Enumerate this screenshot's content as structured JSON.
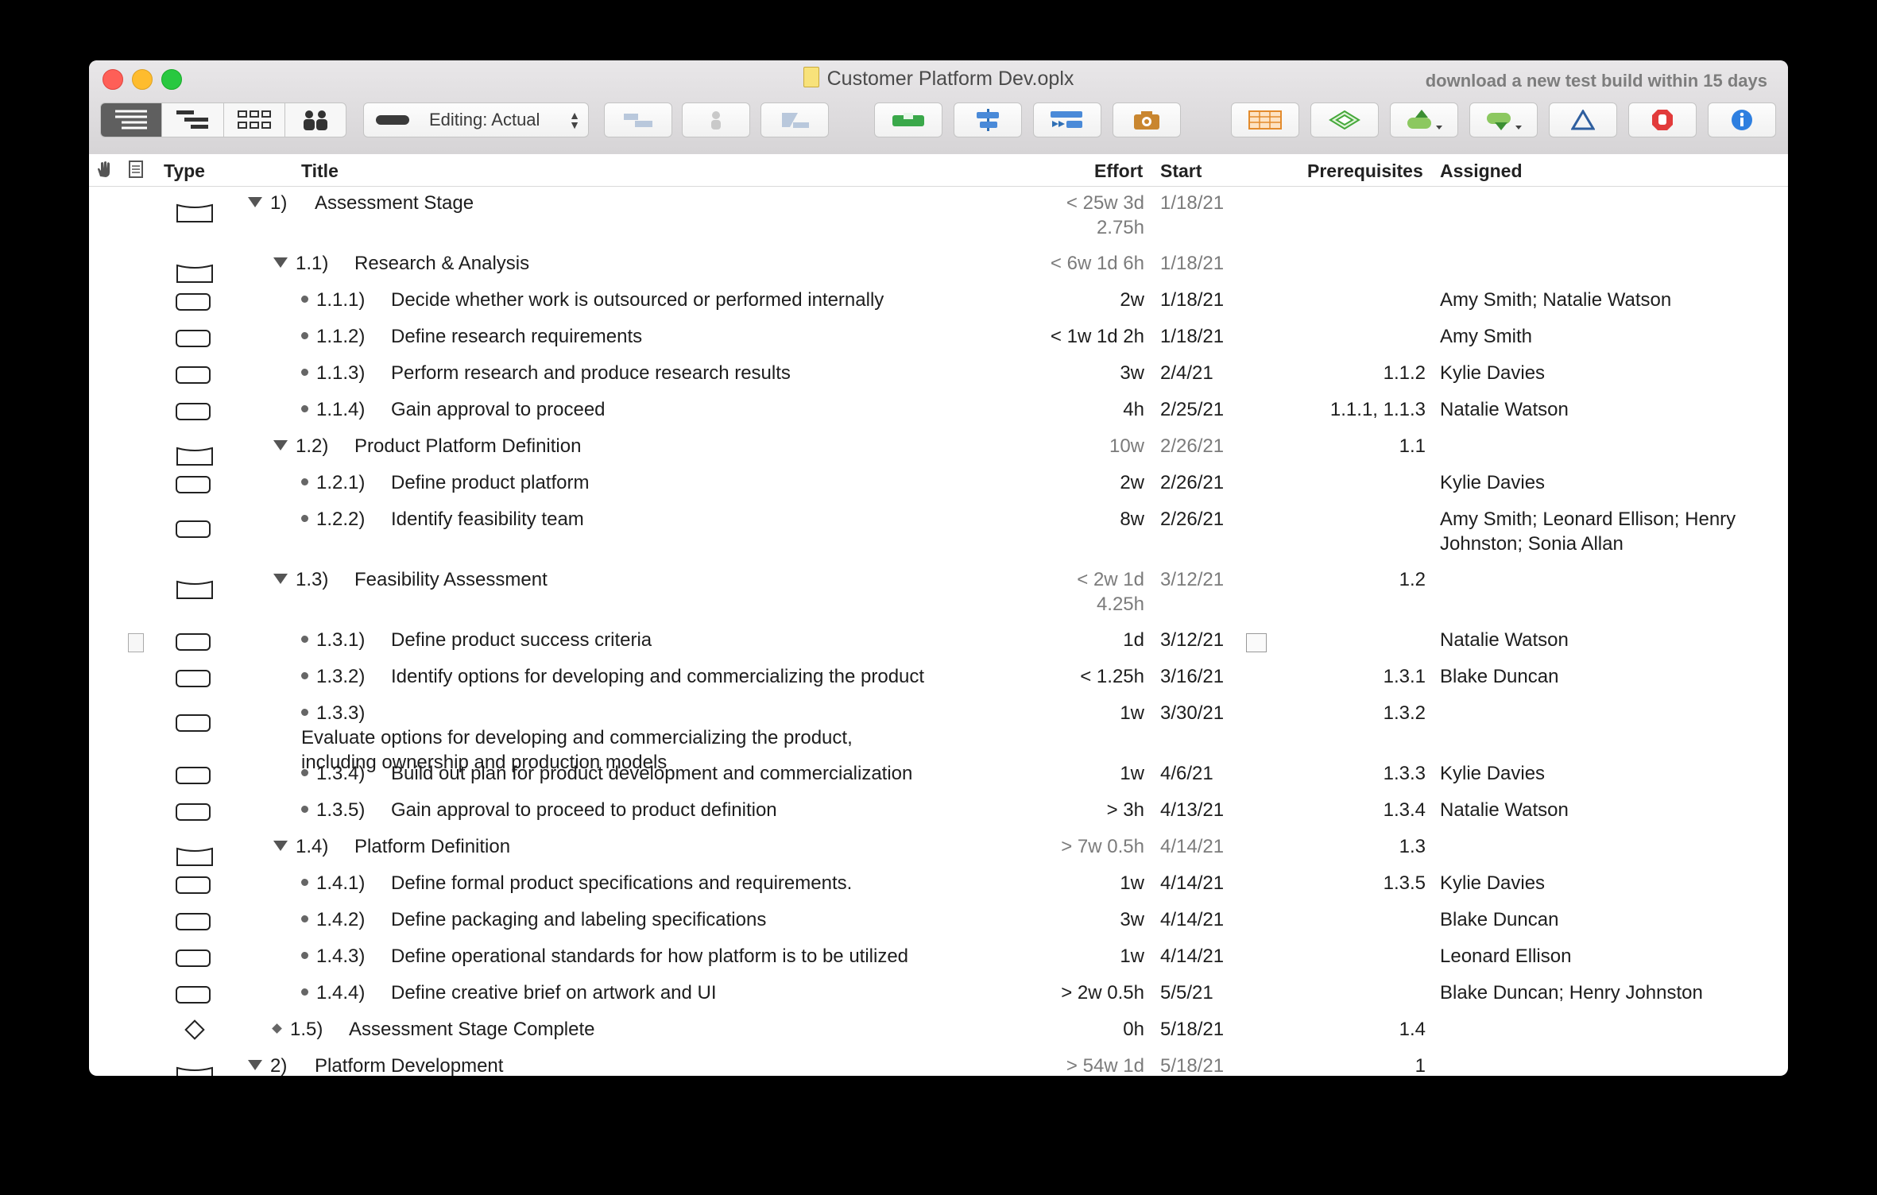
{
  "window": {
    "title": "Customer Platform Dev.oplx",
    "notice": "download a new test build within 15 days"
  },
  "toolbar": {
    "view_modes": [
      "task-outline",
      "gantt",
      "network",
      "resources"
    ],
    "editing_label": "Editing: Actual",
    "buttons": [
      "connect",
      "assign-resource",
      "split",
      "level",
      "center",
      "catch-up",
      "snapshot",
      "spreadsheet",
      "baseline",
      "publish",
      "import",
      "violations",
      "stop",
      "inspector"
    ]
  },
  "columns": {
    "type": "Type",
    "title": "Title",
    "effort": "Effort",
    "start": "Start",
    "prerequisites": "Prerequisites",
    "assigned": "Assigned"
  },
  "rows": [
    {
      "num": "1)",
      "title": "Assessment Stage",
      "effort": "< 25w 3d 2.75h",
      "start": "1/18/21",
      "prereq": "",
      "assigned": "",
      "kind": "group",
      "level": 0,
      "mark": "tri"
    },
    {
      "num": "1.1)",
      "title": "Research & Analysis",
      "effort": "< 6w 1d 6h",
      "start": "1/18/21",
      "prereq": "",
      "assigned": "",
      "kind": "group",
      "level": 1,
      "mark": "tri"
    },
    {
      "num": "1.1.1)",
      "title": "Decide whether work is outsourced or performed internally",
      "effort": "2w",
      "start": "1/18/21",
      "prereq": "",
      "assigned": "Amy Smith; Natalie Watson",
      "kind": "task",
      "level": 2,
      "mark": "dot"
    },
    {
      "num": "1.1.2)",
      "title": "Define research requirements",
      "effort": "< 1w 1d 2h",
      "start": "1/18/21",
      "prereq": "",
      "assigned": "Amy Smith",
      "kind": "task",
      "level": 2,
      "mark": "dot"
    },
    {
      "num": "1.1.3)",
      "title": "Perform research and produce research results",
      "effort": "3w",
      "start": "2/4/21",
      "prereq": "1.1.2",
      "assigned": "Kylie Davies",
      "kind": "task",
      "level": 2,
      "mark": "dot"
    },
    {
      "num": "1.1.4)",
      "title": "Gain approval to proceed",
      "effort": "4h",
      "start": "2/25/21",
      "prereq": "1.1.1, 1.1.3",
      "assigned": "Natalie Watson",
      "kind": "task",
      "level": 2,
      "mark": "dot"
    },
    {
      "num": "1.2)",
      "title": "Product Platform Definition",
      "effort": "10w",
      "start": "2/26/21",
      "prereq": "1.1",
      "assigned": "",
      "kind": "group",
      "level": 1,
      "mark": "tri"
    },
    {
      "num": "1.2.1)",
      "title": "Define product platform",
      "effort": "2w",
      "start": "2/26/21",
      "prereq": "",
      "assigned": "Kylie Davies",
      "kind": "task",
      "level": 2,
      "mark": "dot"
    },
    {
      "num": "1.2.2)",
      "title": "Identify feasibility team",
      "effort": "8w",
      "start": "2/26/21",
      "prereq": "",
      "assigned": "Amy Smith; Leonard Ellison; Henry Johnston; Sonia Allan",
      "kind": "task",
      "level": 2,
      "mark": "dot"
    },
    {
      "num": "1.3)",
      "title": "Feasibility Assessment",
      "effort": "< 2w 1d 4.25h",
      "start": "3/12/21",
      "prereq": "1.2",
      "assigned": "",
      "kind": "group",
      "level": 1,
      "mark": "tri"
    },
    {
      "num": "1.3.1)",
      "title": "Define product success criteria",
      "effort": "1d",
      "start": "3/12/21",
      "prereq": "",
      "assigned": "Natalie Watson",
      "kind": "task",
      "level": 2,
      "mark": "dot"
    },
    {
      "num": "1.3.2)",
      "title": "Identify options for developing and commercializing the product",
      "effort": "< 1.25h",
      "start": "3/16/21",
      "prereq": "1.3.1",
      "assigned": "Blake Duncan",
      "kind": "task",
      "level": 2,
      "mark": "dot"
    },
    {
      "num": "1.3.3)",
      "title": "Evaluate options for developing and commercializing the product, including ownership and production models",
      "effort": "1w",
      "start": "3/30/21",
      "prereq": "1.3.2",
      "assigned": "",
      "kind": "task",
      "level": 2,
      "mark": "dot"
    },
    {
      "num": "1.3.4)",
      "title": "Build out plan for product development and commercialization",
      "effort": "1w",
      "start": "4/6/21",
      "prereq": "1.3.3",
      "assigned": "Kylie Davies",
      "kind": "task",
      "level": 2,
      "mark": "dot"
    },
    {
      "num": "1.3.5)",
      "title": "Gain approval to proceed to product definition",
      "effort": "> 3h",
      "start": "4/13/21",
      "prereq": "1.3.4",
      "assigned": "Natalie Watson",
      "kind": "task",
      "level": 2,
      "mark": "dot"
    },
    {
      "num": "1.4)",
      "title": "Platform Definition",
      "effort": "> 7w 0.5h",
      "start": "4/14/21",
      "prereq": "1.3",
      "assigned": "",
      "kind": "group",
      "level": 1,
      "mark": "tri"
    },
    {
      "num": "1.4.1)",
      "title": "Define formal product specifications and requirements.",
      "effort": "1w",
      "start": "4/14/21",
      "prereq": "1.3.5",
      "assigned": "Kylie Davies",
      "kind": "task",
      "level": 2,
      "mark": "dot"
    },
    {
      "num": "1.4.2)",
      "title": "Define packaging and labeling specifications",
      "effort": "3w",
      "start": "4/14/21",
      "prereq": "",
      "assigned": "Blake Duncan",
      "kind": "task",
      "level": 2,
      "mark": "dot"
    },
    {
      "num": "1.4.3)",
      "title": "Define operational standards for how platform is to be utilized",
      "effort": "1w",
      "start": "4/14/21",
      "prereq": "",
      "assigned": "Leonard Ellison",
      "kind": "task",
      "level": 2,
      "mark": "dot"
    },
    {
      "num": "1.4.4)",
      "title": "Define creative brief on artwork and UI",
      "effort": "> 2w 0.5h",
      "start": "5/5/21",
      "prereq": "",
      "assigned": "Blake Duncan; Henry Johnston",
      "kind": "task",
      "level": 2,
      "mark": "dot"
    },
    {
      "num": "1.5)",
      "title": "Assessment Stage Complete",
      "effort": "0h",
      "start": "5/18/21",
      "prereq": "1.4",
      "assigned": "",
      "kind": "milestone",
      "level": 1,
      "mark": "dia"
    },
    {
      "num": "2)",
      "title": "Platform Development",
      "effort": "> 54w 1d",
      "start": "5/18/21",
      "prereq": "1",
      "assigned": "",
      "kind": "group",
      "level": 0,
      "mark": "tri"
    }
  ]
}
